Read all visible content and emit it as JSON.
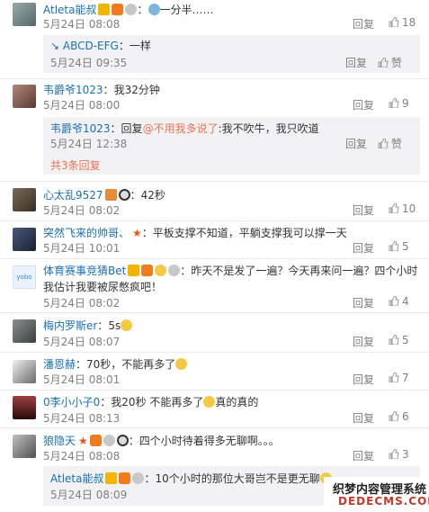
{
  "labels": {
    "reply": "回复",
    "like_zero": "赞"
  },
  "comments": [
    {
      "name": "Atleta能叔",
      "sep": "：",
      "text": "一分半……",
      "time": "5月24日 08:08",
      "likes": "18",
      "sub": {
        "name": "ABCD-EFG",
        "text": "：一样",
        "time": "5月24日 09:35",
        "likes": "赞"
      }
    },
    {
      "name": "韦爵爷1023",
      "sep": "：",
      "text": "我32分钟",
      "time": "5月24日 08:00",
      "likes": "9",
      "sub": {
        "name": "韦爵爷1023",
        "pre": "：回复",
        "mention": "@不用我多说了",
        "text": ":我不吹牛，我只吹道",
        "time": "5月24日 12:38",
        "likes": "赞",
        "more": "共3条回复"
      }
    },
    {
      "name": "心太乱9527",
      "sep": "：",
      "text": "42秒",
      "time": "5月24日 08:02",
      "likes": "10"
    },
    {
      "name": "突然飞来的帅哥、",
      "sep": "：",
      "text": "平板支撑不知道，平躺支撑我可以撑一天",
      "time": "5月24日 10:01",
      "likes": "5"
    },
    {
      "name": "体育赛事竞猜Bet",
      "sep": "：",
      "text": "昨天不是发了一遍？今天再来问一遍？四个小时",
      "text2": "我估计我要被尿憋疯吧！",
      "time": "5月24日 08:02",
      "likes": "4"
    },
    {
      "name": "梅内罗斯er",
      "sep": "：",
      "text": "5s",
      "time": "5月24日 08:07",
      "likes": "5"
    },
    {
      "name": "潘恩赫",
      "sep": "：",
      "text": "70秒，不能再多了",
      "time": "5月24日 08:01",
      "likes": "7"
    },
    {
      "name": "0李小小子0",
      "sep": "：",
      "text": "我20秒  不能再多了",
      "text_b": "真的真的",
      "time": "5月24日 08:13",
      "likes": "6"
    },
    {
      "name": "狼隐天",
      "sep": "：",
      "text": "四个小时待着得多无聊啊。。。",
      "time": "5月24日 08:08",
      "likes": "3",
      "sub": {
        "name": "Atleta能叔",
        "text": "：10个小时的那位大哥岂不是更无聊",
        "time": "5月24日 08:09"
      }
    }
  ],
  "watermark": {
    "line1": "织梦内容管理系统",
    "line2": "DEDECMS.COM"
  },
  "colors": {
    "accent": "#eb7350",
    "link": "#1a6fb8",
    "muted": "#808080",
    "subbox": "#f2f2f5"
  }
}
